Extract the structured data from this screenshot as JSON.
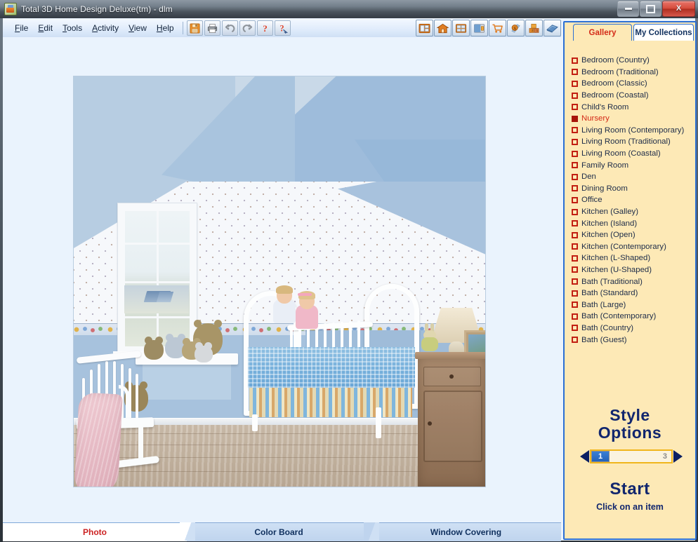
{
  "window": {
    "title": "Total 3D Home Design Deluxe(tm) - dlm",
    "app_icon": "house-app-icon",
    "buttons": {
      "minimize": "minimize-button",
      "maximize": "maximize-button",
      "close": "close-button",
      "close_glyph": "X"
    }
  },
  "menu": {
    "items": [
      {
        "accel": "F",
        "rest": "ile"
      },
      {
        "accel": "E",
        "rest": "dit"
      },
      {
        "accel": "T",
        "rest": "ools"
      },
      {
        "accel": "A",
        "rest": "ctivity"
      },
      {
        "accel": "V",
        "rest": "iew"
      },
      {
        "accel": "H",
        "rest": "elp"
      }
    ]
  },
  "toolbar_left": {
    "buttons": [
      {
        "name": "save-icon",
        "tooltip": "Save"
      },
      {
        "name": "print-icon",
        "tooltip": "Print"
      },
      {
        "name": "undo-icon",
        "tooltip": "Undo"
      },
      {
        "name": "redo-icon",
        "tooltip": "Redo"
      },
      {
        "name": "help-icon",
        "tooltip": "Help"
      },
      {
        "name": "context-help-icon",
        "tooltip": "What's This Help"
      }
    ]
  },
  "toolbar_right": {
    "buttons": [
      {
        "name": "floor-plan-icon",
        "tooltip": "Floor Plan"
      },
      {
        "name": "house-exterior-icon",
        "tooltip": "Exterior"
      },
      {
        "name": "window-design-icon",
        "tooltip": "Windows"
      },
      {
        "name": "room-view-icon",
        "tooltip": "Room View"
      },
      {
        "name": "shopping-cart-icon",
        "tooltip": "Shopping List"
      },
      {
        "name": "budget-dollar-icon",
        "tooltip": "Budget"
      },
      {
        "name": "building-blocks-icon",
        "tooltip": "Materials"
      },
      {
        "name": "carpet-swatch-icon",
        "tooltip": "Flooring"
      }
    ]
  },
  "bottom_tabs": {
    "items": [
      {
        "label": "Photo",
        "active": true
      },
      {
        "label": "Color Board",
        "active": false
      },
      {
        "label": "Window Covering",
        "active": false
      }
    ]
  },
  "right_panel": {
    "tabs": [
      {
        "label": "Gallery",
        "active": true
      },
      {
        "label": "My Collections",
        "active": false
      }
    ],
    "gallery_items": [
      {
        "label": "Bedroom (Country)",
        "selected": false
      },
      {
        "label": "Bedroom (Traditional)",
        "selected": false
      },
      {
        "label": "Bedroom (Classic)",
        "selected": false
      },
      {
        "label": "Bedroom (Coastal)",
        "selected": false
      },
      {
        "label": "Child's Room",
        "selected": false
      },
      {
        "label": "Nursery",
        "selected": true
      },
      {
        "label": "Living Room (Contemporary)",
        "selected": false
      },
      {
        "label": "Living Room (Traditional)",
        "selected": false
      },
      {
        "label": "Living Room (Coastal)",
        "selected": false
      },
      {
        "label": "Family Room",
        "selected": false
      },
      {
        "label": "Den",
        "selected": false
      },
      {
        "label": "Dining Room",
        "selected": false
      },
      {
        "label": "Office",
        "selected": false
      },
      {
        "label": "Kitchen (Galley)",
        "selected": false
      },
      {
        "label": "Kitchen (Island)",
        "selected": false
      },
      {
        "label": "Kitchen (Open)",
        "selected": false
      },
      {
        "label": "Kitchen (Contemporary)",
        "selected": false
      },
      {
        "label": "Kitchen (L-Shaped)",
        "selected": false
      },
      {
        "label": "Kitchen (U-Shaped)",
        "selected": false
      },
      {
        "label": "Bath (Traditional)",
        "selected": false
      },
      {
        "label": "Bath (Standard)",
        "selected": false
      },
      {
        "label": "Bath (Large)",
        "selected": false
      },
      {
        "label": "Bath (Contemporary)",
        "selected": false
      },
      {
        "label": "Bath (Country)",
        "selected": false
      },
      {
        "label": "Bath (Guest)",
        "selected": false
      }
    ],
    "style_options": {
      "title_line1": "Style",
      "title_line2": "Options",
      "current": "1",
      "total": "3",
      "prev_arrow": "left-arrow-icon",
      "next_arrow": "right-arrow-icon"
    },
    "start": {
      "title": "Start",
      "subtitle": "Click on an item"
    }
  },
  "photo": {
    "name": "nursery-room-photo",
    "description": "Nursery room with white crib, two toddlers, rocking chair with pink blanket, teddy bears on window bench, wooden nightstand with lamp"
  },
  "colors": {
    "accent_blue": "#2b6fd4",
    "panel_cream": "#fde9b6",
    "selected_red": "#d42b18",
    "checkbox_red": "#c21f12",
    "navy_text": "#11266e",
    "canvas_bg": "#eaf3fd"
  }
}
